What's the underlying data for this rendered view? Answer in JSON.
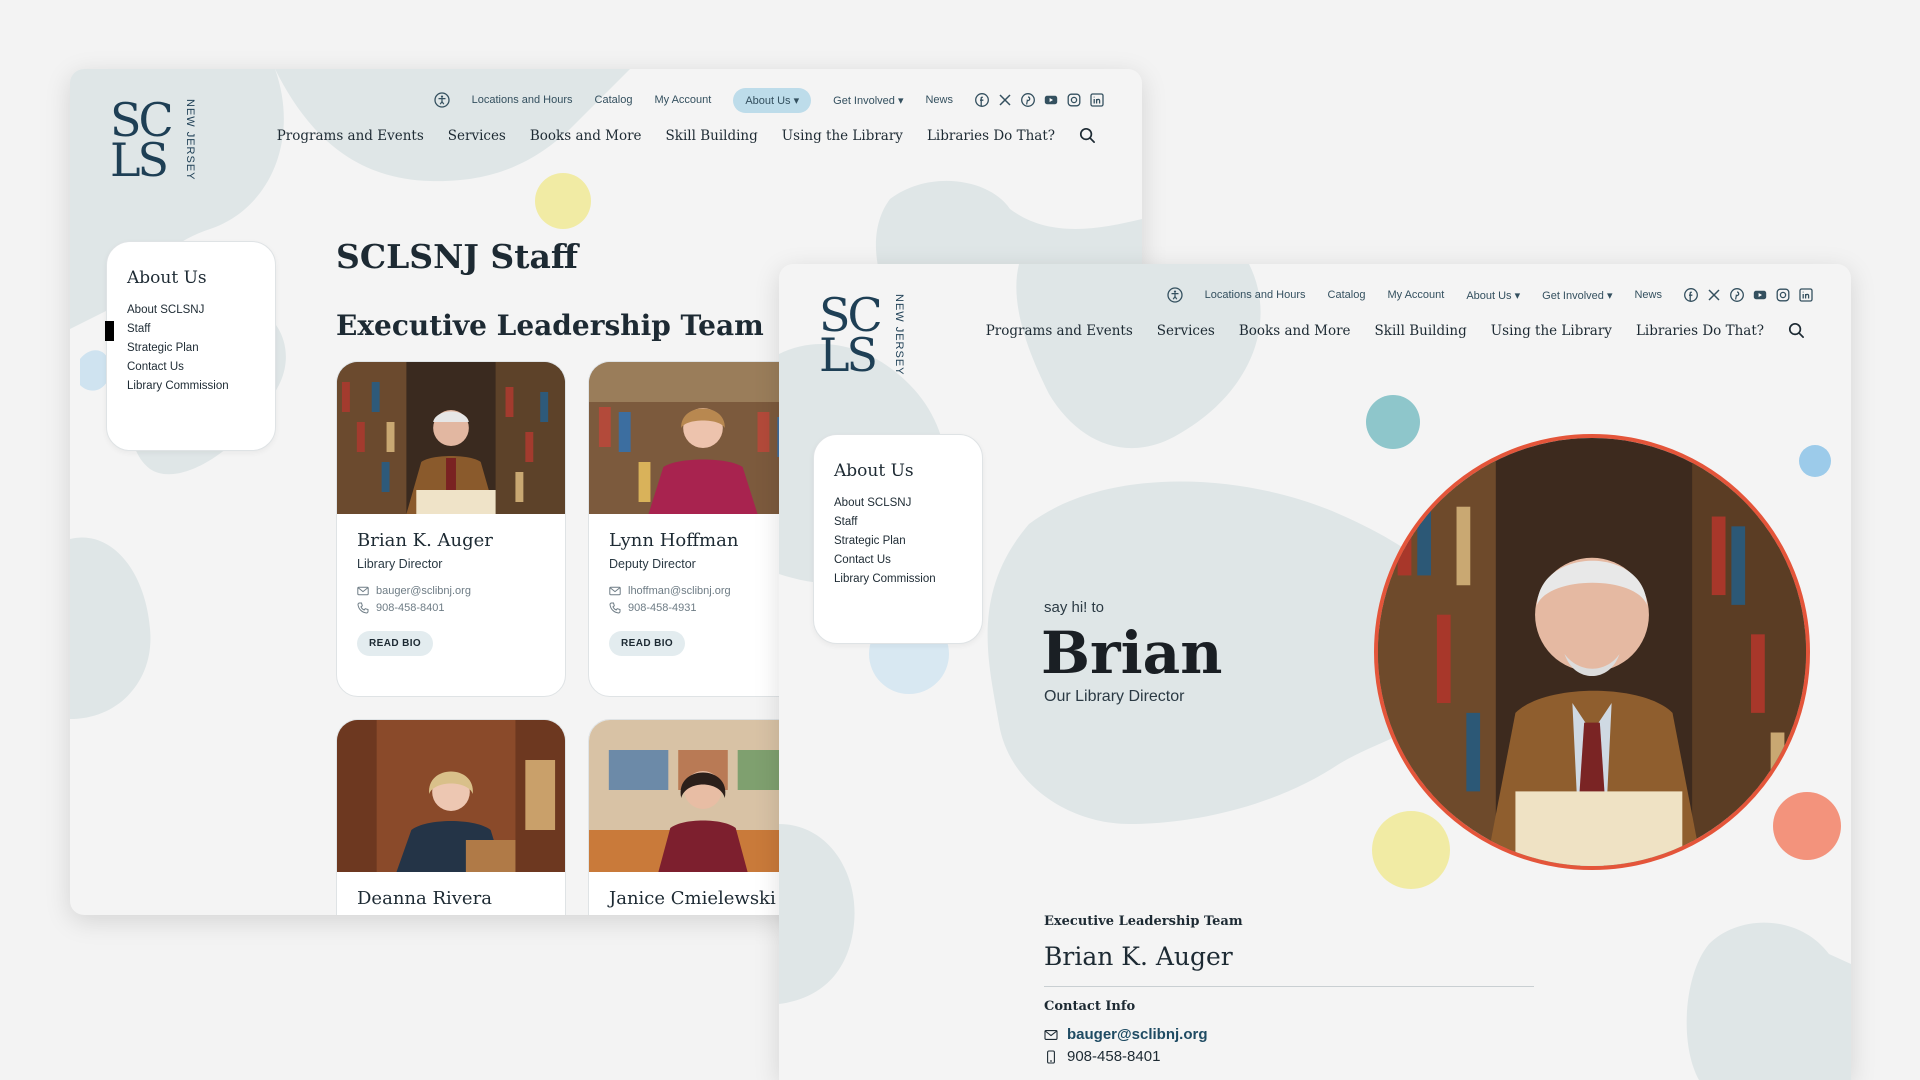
{
  "brand": {
    "logo_top": "SC",
    "logo_bottom": "LS",
    "logo_side": "NEW JERSEY"
  },
  "utility_nav": [
    "Locations and Hours",
    "Catalog",
    "My Account",
    "About Us ▾",
    "Get Involved ▾",
    "News"
  ],
  "social_icons": [
    "facebook-icon",
    "x-icon",
    "pinterest-icon",
    "youtube-icon",
    "instagram-icon",
    "linkedin-icon"
  ],
  "main_nav": [
    "Programs and Events",
    "Services",
    "Books and More",
    "Skill Building",
    "Using the Library",
    "Libraries Do That?"
  ],
  "sidebar": {
    "title": "About Us",
    "items": [
      "About SCLSNJ",
      "Staff",
      "Strategic Plan",
      "Contact Us",
      "Library Commission"
    ],
    "current": "Staff"
  },
  "staff_page": {
    "title": "SCLSNJ Staff",
    "section": "Executive Leadership Team",
    "read_bio_label": "READ BIO",
    "cards": [
      {
        "name": "Brian K. Auger",
        "title": "Library Director",
        "email": "bauger@sclibnj.org",
        "phone": "908-458-8401"
      },
      {
        "name": "Lynn Hoffman",
        "title": "Deputy Director",
        "email": "lhoffman@sclibnj.org",
        "phone": "908-458-4931"
      },
      {
        "name": "Deanna Rivera"
      },
      {
        "name": "Janice Cmielewski"
      }
    ]
  },
  "profile_page": {
    "greeting": "say hi! to",
    "first_name": "Brian",
    "role": "Our Library Director",
    "team": "Executive Leadership Team",
    "full_name": "Brian K. Auger",
    "contact_label": "Contact Info",
    "email": "bauger@sclibnj.org",
    "phone": "908-458-8401"
  },
  "colors": {
    "accent_pill": "#bddcea",
    "portrait_ring": "#e4553a",
    "blob": "#dfe6e7",
    "dot_yellow": "#f1eba4",
    "dot_teal": "#8ec6cb",
    "dot_blue": "#9ccbea",
    "dot_salmon": "#f3937c"
  }
}
